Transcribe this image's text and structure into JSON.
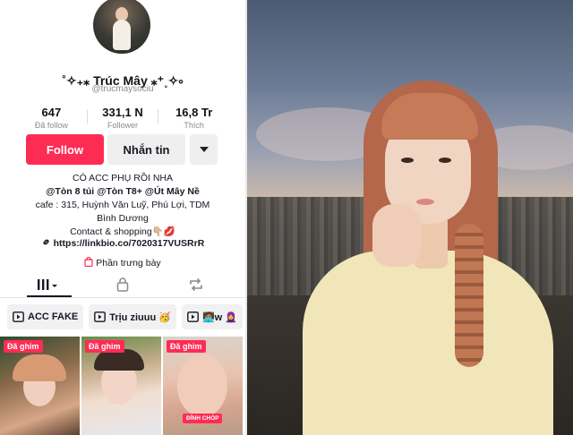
{
  "profile": {
    "display_name": "˚✧₊⁎ Trúc Mây ⁎⁺˳✧༚",
    "username": "@trucmaysociu",
    "stats": [
      {
        "value": "647",
        "label": "Đã follow"
      },
      {
        "value": "331,1 N",
        "label": "Follower"
      },
      {
        "value": "16,8 Tr",
        "label": "Thích"
      }
    ],
    "buttons": {
      "follow": "Follow",
      "message": "Nhắn tin"
    },
    "bio": {
      "line1": "CÓ ACC PHỤ RỒI NHA",
      "line2": "@Tòn 8 tủi @Tòn T8+ @Út Mây Nề",
      "line3": "cafe : 315, Huỳnh Văn Luỹ, Phú Lợi, TDM",
      "line4": "Bình Dương",
      "line5": "Contact & shopping👇🏼💋"
    },
    "link": "https://linkbio.co/7020317VUSRrR",
    "showcase": "Phần trưng bày"
  },
  "playlists": [
    {
      "label": "ACC FAKE"
    },
    {
      "label": "Trịu ziuuu 🥳"
    },
    {
      "label": "🧑🏽‍💻w 🧕"
    }
  ],
  "videos": [
    {
      "badge": "Đã ghim",
      "tag": ""
    },
    {
      "badge": "Đã ghim",
      "tag": ""
    },
    {
      "badge": "Đã ghim",
      "tag": "ĐỈNH CHÓP"
    }
  ],
  "colors": {
    "accent": "#fe2c55",
    "button_bg": "#efefef"
  },
  "icons": {
    "tab_videos": "grid-icon",
    "tab_private": "lock-icon",
    "tab_reposts": "repost-icon",
    "playlist": "playlist-icon",
    "link": "link-icon",
    "showcase": "bag-icon"
  }
}
